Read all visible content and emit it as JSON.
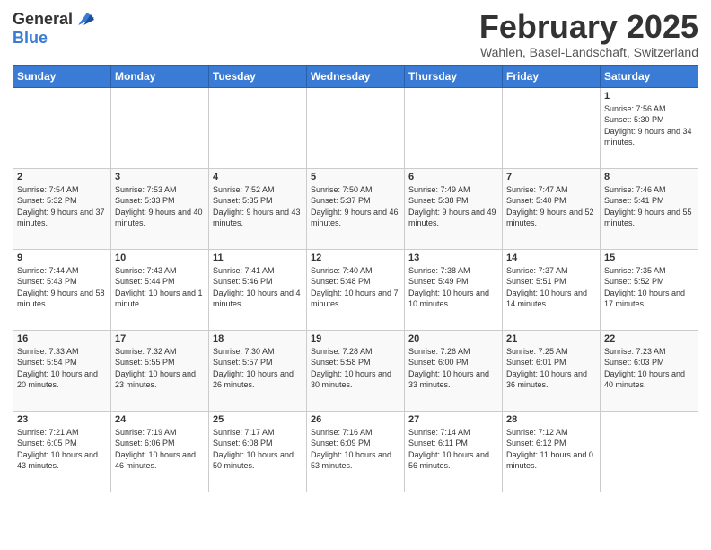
{
  "logo": {
    "general": "General",
    "blue": "Blue"
  },
  "title": "February 2025",
  "subtitle": "Wahlen, Basel-Landschaft, Switzerland",
  "days_of_week": [
    "Sunday",
    "Monday",
    "Tuesday",
    "Wednesday",
    "Thursday",
    "Friday",
    "Saturday"
  ],
  "weeks": [
    [
      {
        "day": "",
        "info": ""
      },
      {
        "day": "",
        "info": ""
      },
      {
        "day": "",
        "info": ""
      },
      {
        "day": "",
        "info": ""
      },
      {
        "day": "",
        "info": ""
      },
      {
        "day": "",
        "info": ""
      },
      {
        "day": "1",
        "info": "Sunrise: 7:56 AM\nSunset: 5:30 PM\nDaylight: 9 hours and 34 minutes."
      }
    ],
    [
      {
        "day": "2",
        "info": "Sunrise: 7:54 AM\nSunset: 5:32 PM\nDaylight: 9 hours and 37 minutes."
      },
      {
        "day": "3",
        "info": "Sunrise: 7:53 AM\nSunset: 5:33 PM\nDaylight: 9 hours and 40 minutes."
      },
      {
        "day": "4",
        "info": "Sunrise: 7:52 AM\nSunset: 5:35 PM\nDaylight: 9 hours and 43 minutes."
      },
      {
        "day": "5",
        "info": "Sunrise: 7:50 AM\nSunset: 5:37 PM\nDaylight: 9 hours and 46 minutes."
      },
      {
        "day": "6",
        "info": "Sunrise: 7:49 AM\nSunset: 5:38 PM\nDaylight: 9 hours and 49 minutes."
      },
      {
        "day": "7",
        "info": "Sunrise: 7:47 AM\nSunset: 5:40 PM\nDaylight: 9 hours and 52 minutes."
      },
      {
        "day": "8",
        "info": "Sunrise: 7:46 AM\nSunset: 5:41 PM\nDaylight: 9 hours and 55 minutes."
      }
    ],
    [
      {
        "day": "9",
        "info": "Sunrise: 7:44 AM\nSunset: 5:43 PM\nDaylight: 9 hours and 58 minutes."
      },
      {
        "day": "10",
        "info": "Sunrise: 7:43 AM\nSunset: 5:44 PM\nDaylight: 10 hours and 1 minute."
      },
      {
        "day": "11",
        "info": "Sunrise: 7:41 AM\nSunset: 5:46 PM\nDaylight: 10 hours and 4 minutes."
      },
      {
        "day": "12",
        "info": "Sunrise: 7:40 AM\nSunset: 5:48 PM\nDaylight: 10 hours and 7 minutes."
      },
      {
        "day": "13",
        "info": "Sunrise: 7:38 AM\nSunset: 5:49 PM\nDaylight: 10 hours and 10 minutes."
      },
      {
        "day": "14",
        "info": "Sunrise: 7:37 AM\nSunset: 5:51 PM\nDaylight: 10 hours and 14 minutes."
      },
      {
        "day": "15",
        "info": "Sunrise: 7:35 AM\nSunset: 5:52 PM\nDaylight: 10 hours and 17 minutes."
      }
    ],
    [
      {
        "day": "16",
        "info": "Sunrise: 7:33 AM\nSunset: 5:54 PM\nDaylight: 10 hours and 20 minutes."
      },
      {
        "day": "17",
        "info": "Sunrise: 7:32 AM\nSunset: 5:55 PM\nDaylight: 10 hours and 23 minutes."
      },
      {
        "day": "18",
        "info": "Sunrise: 7:30 AM\nSunset: 5:57 PM\nDaylight: 10 hours and 26 minutes."
      },
      {
        "day": "19",
        "info": "Sunrise: 7:28 AM\nSunset: 5:58 PM\nDaylight: 10 hours and 30 minutes."
      },
      {
        "day": "20",
        "info": "Sunrise: 7:26 AM\nSunset: 6:00 PM\nDaylight: 10 hours and 33 minutes."
      },
      {
        "day": "21",
        "info": "Sunrise: 7:25 AM\nSunset: 6:01 PM\nDaylight: 10 hours and 36 minutes."
      },
      {
        "day": "22",
        "info": "Sunrise: 7:23 AM\nSunset: 6:03 PM\nDaylight: 10 hours and 40 minutes."
      }
    ],
    [
      {
        "day": "23",
        "info": "Sunrise: 7:21 AM\nSunset: 6:05 PM\nDaylight: 10 hours and 43 minutes."
      },
      {
        "day": "24",
        "info": "Sunrise: 7:19 AM\nSunset: 6:06 PM\nDaylight: 10 hours and 46 minutes."
      },
      {
        "day": "25",
        "info": "Sunrise: 7:17 AM\nSunset: 6:08 PM\nDaylight: 10 hours and 50 minutes."
      },
      {
        "day": "26",
        "info": "Sunrise: 7:16 AM\nSunset: 6:09 PM\nDaylight: 10 hours and 53 minutes."
      },
      {
        "day": "27",
        "info": "Sunrise: 7:14 AM\nSunset: 6:11 PM\nDaylight: 10 hours and 56 minutes."
      },
      {
        "day": "28",
        "info": "Sunrise: 7:12 AM\nSunset: 6:12 PM\nDaylight: 11 hours and 0 minutes."
      },
      {
        "day": "",
        "info": ""
      }
    ]
  ]
}
